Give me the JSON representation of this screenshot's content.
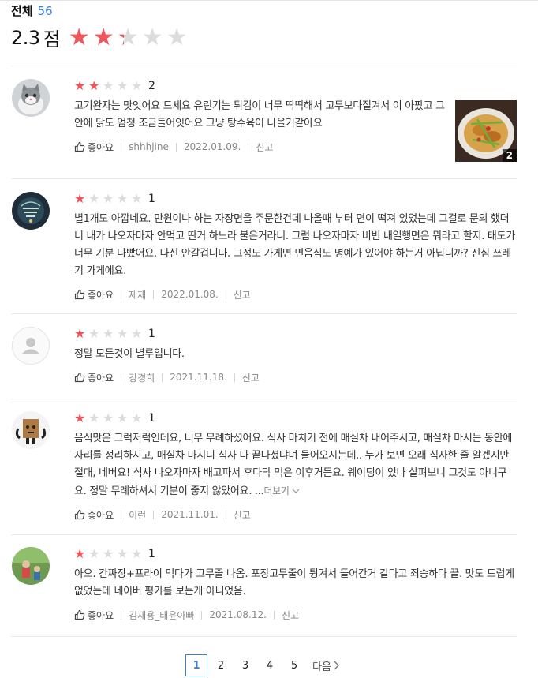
{
  "summary": {
    "total_label": "전체",
    "total_count": "56",
    "score": "2.3",
    "score_unit": "점",
    "rating": 2.3,
    "max_rating": 5
  },
  "like_label": "좋아요",
  "report_label": "신고",
  "reviews": [
    {
      "rating": 2,
      "rating_text": "2",
      "text": "고기완자는 맛잇어요 드세요 유린기는 튀김이 너무 딱딱해서 고무보다질겨서 이 아팠고 그 안에 닭도 엄청 조금들어잇어요 그냥 탕수육이 나을거같아요",
      "author": "shhhjine",
      "date": "2022.01.09.",
      "photo_count": "2"
    },
    {
      "rating": 1,
      "rating_text": "1",
      "text": "별1개도  아깝네요. 만원이나 하는 자장면을 주문한건데 나올때 부터 면이 떡져 있었는데 그걸로 문의 했더니 내가 나오자마자 안먹고 딴거 하느라 불은거라니. 그럼 나오자마자 비빈 내일행면은  뭐라고 할지. 태도가 너무 기분 나빴어요. 다신 안갈겁니다. 그정도 가게면 면음식도 명예가 있어야 하는거 아닙니까? 진심 쓰레기 가게에요.",
      "author": "제제",
      "date": "2022.01.08."
    },
    {
      "rating": 1,
      "rating_text": "1",
      "text": "정말 모든것이 별루입니다.",
      "author": "강경희",
      "date": "2021.11.18."
    },
    {
      "rating": 1,
      "rating_text": "1",
      "text": "음식맛은 그럭저럭인데요, 너무 무례하셨어요. 식사 마치기 전에 매실차 내어주시고, 매실차 마시는 동안에 자리를 정리하시고, 매실차 마시니 식사 다 끝나셨냐며 물어오시는데.. 누가 보면 오래 식사한 줄 알겠지만 절대, 네버요! 식사 나오자마자 배고파서 후다닥 먹은 이후거든요. 웨이팅이 있나 살펴보니 그것도 아니구요. 정말 무례하셔서 기분이 좋지 않았어요. ...",
      "more_label": "더보기",
      "author": "이런",
      "date": "2021.11.01."
    },
    {
      "rating": 1,
      "rating_text": "1",
      "text": "아오. 간짜장+프라이 먹다가 고무줄 나옴. 포장고무줄이 튕겨서 들어간거 같다고 죄송하다 끝. 맛도 드럽게 없었는데 네이버 평가를 보는게 아니었음.",
      "author": "김재용_태윤아빠",
      "date": "2021.08.12."
    }
  ],
  "pagination": {
    "pages": [
      "1",
      "2",
      "3",
      "4",
      "5"
    ],
    "current": "1",
    "next_label": "다음"
  },
  "colors": {
    "accent": "#3d7fd6",
    "star_filled": "#f2545b",
    "star_empty": "#dcdcdc"
  }
}
